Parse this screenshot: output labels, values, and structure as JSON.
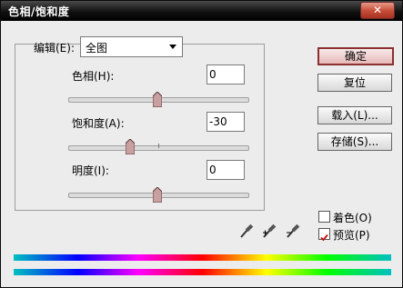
{
  "window": {
    "title": "色相/饱和度",
    "close_icon": "close-icon"
  },
  "edit": {
    "label": "编辑(E):",
    "value": "全图"
  },
  "hue": {
    "label": "色相(H):",
    "value": "0",
    "slider": 0
  },
  "saturation": {
    "label": "饱和度(A):",
    "value": "-30",
    "slider": -30
  },
  "lightness": {
    "label": "明度(I):",
    "value": "0",
    "slider": 0
  },
  "buttons": {
    "ok": "确定",
    "reset": "复位",
    "load": "载入(L)...",
    "save": "存储(S)..."
  },
  "options": {
    "colorize_label": "着色(O)",
    "colorize_checked": false,
    "preview_label": "预览(P)",
    "preview_checked": true
  },
  "accent": "#c08080"
}
